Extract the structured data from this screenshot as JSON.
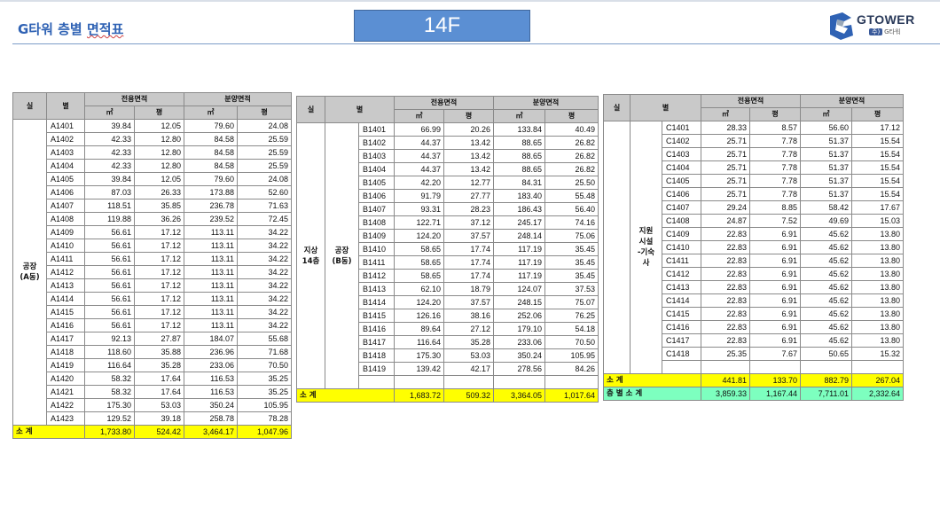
{
  "header": {
    "title_prefix": "G타워 층별 ",
    "title_underlined": "면적표",
    "floor": "14F",
    "logo_text": "GTOWER",
    "logo_pill": "주)",
    "logo_sub": "G타워"
  },
  "columns": {
    "room_a": "실",
    "room_b": "별",
    "exclusive": "전용면적",
    "sale": "분양면적",
    "sqm": "㎡",
    "pyeong": "평"
  },
  "table_a": {
    "group_label": "공장\n(A동)",
    "rows": [
      [
        "A1401",
        "39.84",
        "12.05",
        "79.60",
        "24.08"
      ],
      [
        "A1402",
        "42.33",
        "12.80",
        "84.58",
        "25.59"
      ],
      [
        "A1403",
        "42.33",
        "12.80",
        "84.58",
        "25.59"
      ],
      [
        "A1404",
        "42.33",
        "12.80",
        "84.58",
        "25.59"
      ],
      [
        "A1405",
        "39.84",
        "12.05",
        "79.60",
        "24.08"
      ],
      [
        "A1406",
        "87.03",
        "26.33",
        "173.88",
        "52.60"
      ],
      [
        "A1407",
        "118.51",
        "35.85",
        "236.78",
        "71.63"
      ],
      [
        "A1408",
        "119.88",
        "36.26",
        "239.52",
        "72.45"
      ],
      [
        "A1409",
        "56.61",
        "17.12",
        "113.11",
        "34.22"
      ],
      [
        "A1410",
        "56.61",
        "17.12",
        "113.11",
        "34.22"
      ],
      [
        "A1411",
        "56.61",
        "17.12",
        "113.11",
        "34.22"
      ],
      [
        "A1412",
        "56.61",
        "17.12",
        "113.11",
        "34.22"
      ],
      [
        "A1413",
        "56.61",
        "17.12",
        "113.11",
        "34.22"
      ],
      [
        "A1414",
        "56.61",
        "17.12",
        "113.11",
        "34.22"
      ],
      [
        "A1415",
        "56.61",
        "17.12",
        "113.11",
        "34.22"
      ],
      [
        "A1416",
        "56.61",
        "17.12",
        "113.11",
        "34.22"
      ],
      [
        "A1417",
        "92.13",
        "27.87",
        "184.07",
        "55.68"
      ],
      [
        "A1418",
        "118.60",
        "35.88",
        "236.96",
        "71.68"
      ],
      [
        "A1419",
        "116.64",
        "35.28",
        "233.06",
        "70.50"
      ],
      [
        "A1420",
        "58.32",
        "17.64",
        "116.53",
        "35.25"
      ],
      [
        "A1421",
        "58.32",
        "17.64",
        "116.53",
        "35.25"
      ],
      [
        "A1422",
        "175.30",
        "53.03",
        "350.24",
        "105.95"
      ],
      [
        "A1423",
        "129.52",
        "39.18",
        "258.78",
        "78.28"
      ]
    ],
    "subtotal": {
      "label": "소  계",
      "values": [
        "1,733.80",
        "524.42",
        "3,464.17",
        "1,047.96"
      ]
    }
  },
  "table_b": {
    "floor_label": "지상\n14층",
    "group_label": "공장\n(B동)",
    "rows": [
      [
        "B1401",
        "66.99",
        "20.26",
        "133.84",
        "40.49"
      ],
      [
        "B1402",
        "44.37",
        "13.42",
        "88.65",
        "26.82"
      ],
      [
        "B1403",
        "44.37",
        "13.42",
        "88.65",
        "26.82"
      ],
      [
        "B1404",
        "44.37",
        "13.42",
        "88.65",
        "26.82"
      ],
      [
        "B1405",
        "42.20",
        "12.77",
        "84.31",
        "25.50"
      ],
      [
        "B1406",
        "91.79",
        "27.77",
        "183.40",
        "55.48"
      ],
      [
        "B1407",
        "93.31",
        "28.23",
        "186.43",
        "56.40"
      ],
      [
        "B1408",
        "122.71",
        "37.12",
        "245.17",
        "74.16"
      ],
      [
        "B1409",
        "124.20",
        "37.57",
        "248.14",
        "75.06"
      ],
      [
        "B1410",
        "58.65",
        "17.74",
        "117.19",
        "35.45"
      ],
      [
        "B1411",
        "58.65",
        "17.74",
        "117.19",
        "35.45"
      ],
      [
        "B1412",
        "58.65",
        "17.74",
        "117.19",
        "35.45"
      ],
      [
        "B1413",
        "62.10",
        "18.79",
        "124.07",
        "37.53"
      ],
      [
        "B1414",
        "124.20",
        "37.57",
        "248.15",
        "75.07"
      ],
      [
        "B1415",
        "126.16",
        "38.16",
        "252.06",
        "76.25"
      ],
      [
        "B1416",
        "89.64",
        "27.12",
        "179.10",
        "54.18"
      ],
      [
        "B1417",
        "116.64",
        "35.28",
        "233.06",
        "70.50"
      ],
      [
        "B1418",
        "175.30",
        "53.03",
        "350.24",
        "105.95"
      ],
      [
        "B1419",
        "139.42",
        "42.17",
        "278.56",
        "84.26"
      ]
    ],
    "subtotal": {
      "label": "소  계",
      "values": [
        "1,683.72",
        "509.32",
        "3,364.05",
        "1,017.64"
      ]
    }
  },
  "table_c": {
    "group_label": "지원\n시설\n-기숙\n사",
    "rows": [
      [
        "C1401",
        "28.33",
        "8.57",
        "56.60",
        "17.12"
      ],
      [
        "C1402",
        "25.71",
        "7.78",
        "51.37",
        "15.54"
      ],
      [
        "C1403",
        "25.71",
        "7.78",
        "51.37",
        "15.54"
      ],
      [
        "C1404",
        "25.71",
        "7.78",
        "51.37",
        "15.54"
      ],
      [
        "C1405",
        "25.71",
        "7.78",
        "51.37",
        "15.54"
      ],
      [
        "C1406",
        "25.71",
        "7.78",
        "51.37",
        "15.54"
      ],
      [
        "C1407",
        "29.24",
        "8.85",
        "58.42",
        "17.67"
      ],
      [
        "C1408",
        "24.87",
        "7.52",
        "49.69",
        "15.03"
      ],
      [
        "C1409",
        "22.83",
        "6.91",
        "45.62",
        "13.80"
      ],
      [
        "C1410",
        "22.83",
        "6.91",
        "45.62",
        "13.80"
      ],
      [
        "C1411",
        "22.83",
        "6.91",
        "45.62",
        "13.80"
      ],
      [
        "C1412",
        "22.83",
        "6.91",
        "45.62",
        "13.80"
      ],
      [
        "C1413",
        "22.83",
        "6.91",
        "45.62",
        "13.80"
      ],
      [
        "C1414",
        "22.83",
        "6.91",
        "45.62",
        "13.80"
      ],
      [
        "C1415",
        "22.83",
        "6.91",
        "45.62",
        "13.80"
      ],
      [
        "C1416",
        "22.83",
        "6.91",
        "45.62",
        "13.80"
      ],
      [
        "C1417",
        "22.83",
        "6.91",
        "45.62",
        "13.80"
      ],
      [
        "C1418",
        "25.35",
        "7.67",
        "50.65",
        "15.32"
      ]
    ],
    "subtotal": {
      "label": "소  계",
      "values": [
        "441.81",
        "133.70",
        "882.79",
        "267.04"
      ]
    },
    "grand_total": {
      "label": "층 별 소 계",
      "values": [
        "3,859.33",
        "1,167.44",
        "7,711.01",
        "2,332.64"
      ]
    }
  },
  "colors": {
    "title": "#2f62b4",
    "badge": "#5b8fd3",
    "subtotal": "#ffff00",
    "grand_total": "#7dffbf",
    "header_cell": "#c9c9c9"
  }
}
